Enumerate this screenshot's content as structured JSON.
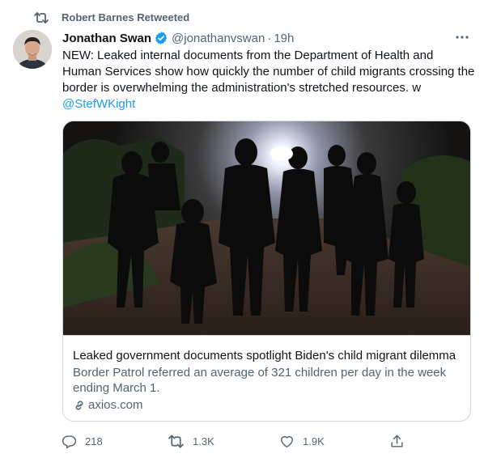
{
  "retweet_context": {
    "text": "Robert Barnes Retweeted",
    "icon": "retweet-icon"
  },
  "author": {
    "name": "Jonathan Swan",
    "handle": "@jonathanvswan",
    "separator": "·",
    "time": "19h",
    "verified": true
  },
  "tweet": {
    "text": "NEW: Leaked internal documents from the Department of Health and Human Services show how quickly the number of child migrants crossing the border is overwhelming the administration's stretched resources. w",
    "mention": "@StefWKight"
  },
  "card": {
    "title": "Leaked government documents spotlight Biden's child migrant dilemma",
    "description": "Border Patrol referred an average of 321 children per day in the week ending March 1.",
    "domain": "axios.com"
  },
  "actions": {
    "reply_count": "218",
    "retweet_count": "1.3K",
    "like_count": "1.9K"
  },
  "colors": {
    "accent": "#1d9bf0",
    "secondary_text": "#536471",
    "border": "#cfd9de"
  }
}
